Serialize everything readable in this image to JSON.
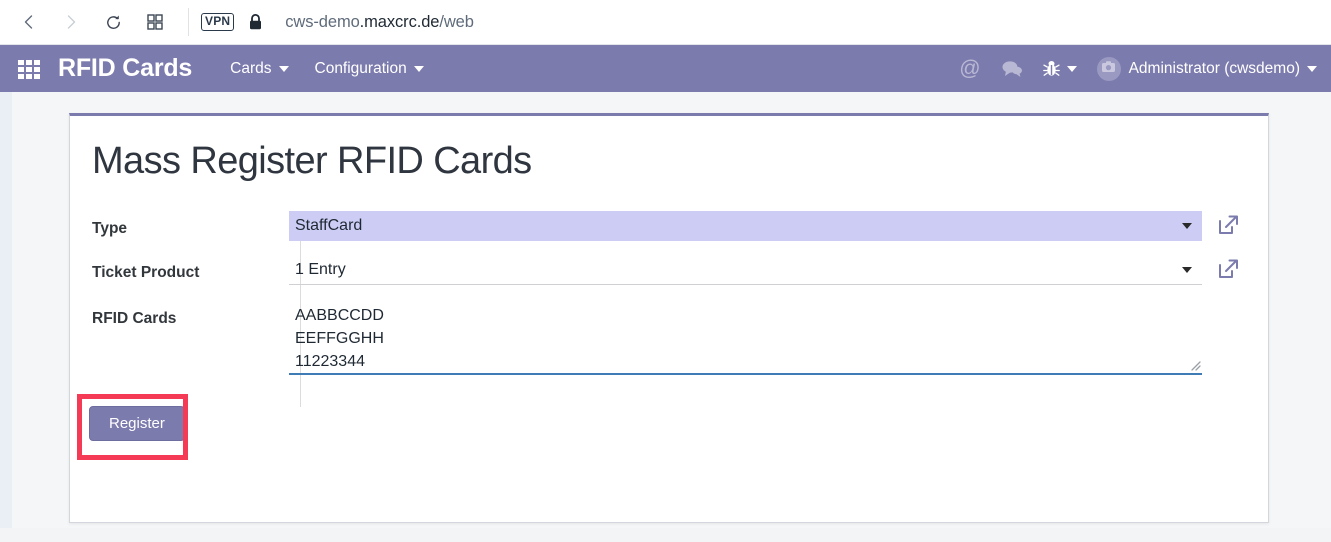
{
  "browser": {
    "back_icon": "chevron-left-icon",
    "forward_icon": "chevron-right-icon",
    "reload_icon": "reload-icon",
    "tabs_icon": "grid-tabs-icon",
    "vpn_badge": "VPN",
    "lock_icon": "lock-icon",
    "url_prefix": "cws-demo",
    "url_host": ".maxcrc.de",
    "url_path": "/web",
    "url_full": "cws-demo.maxcrc.de/web"
  },
  "navbar": {
    "apps_icon": "apps-grid-icon",
    "brand": "RFID Cards",
    "menus": [
      {
        "label": "Cards"
      },
      {
        "label": "Configuration"
      }
    ],
    "mention_icon": "at-mention-icon",
    "messages_icon": "chat-bubble-icon",
    "debug_icon": "bug-icon",
    "avatar_icon": "camera-avatar-icon",
    "user": "Administrator (cwsdemo)",
    "background_color": "#7c7bad"
  },
  "form": {
    "title": "Mass Register RFID Cards",
    "fields": {
      "type": {
        "label": "Type",
        "value": "StaffCard",
        "selected": true,
        "external_link_icon": "external-link-icon",
        "caret_icon": "chevron-down-icon"
      },
      "ticket_product": {
        "label": "Ticket Product",
        "value": "1 Entry",
        "external_link_icon": "external-link-icon",
        "caret_icon": "chevron-down-icon"
      },
      "rfid_cards": {
        "label": "RFID Cards",
        "lines": [
          "AABBCCDD",
          "EEFFGGHH",
          "11223344"
        ],
        "value": "AABBCCDD\nEEFFGGHH\n11223344",
        "resize_icon": "resize-grip-icon"
      }
    },
    "register_button": "Register",
    "highlight_color": "#f43a55",
    "accent_color": "#7c7bad"
  }
}
